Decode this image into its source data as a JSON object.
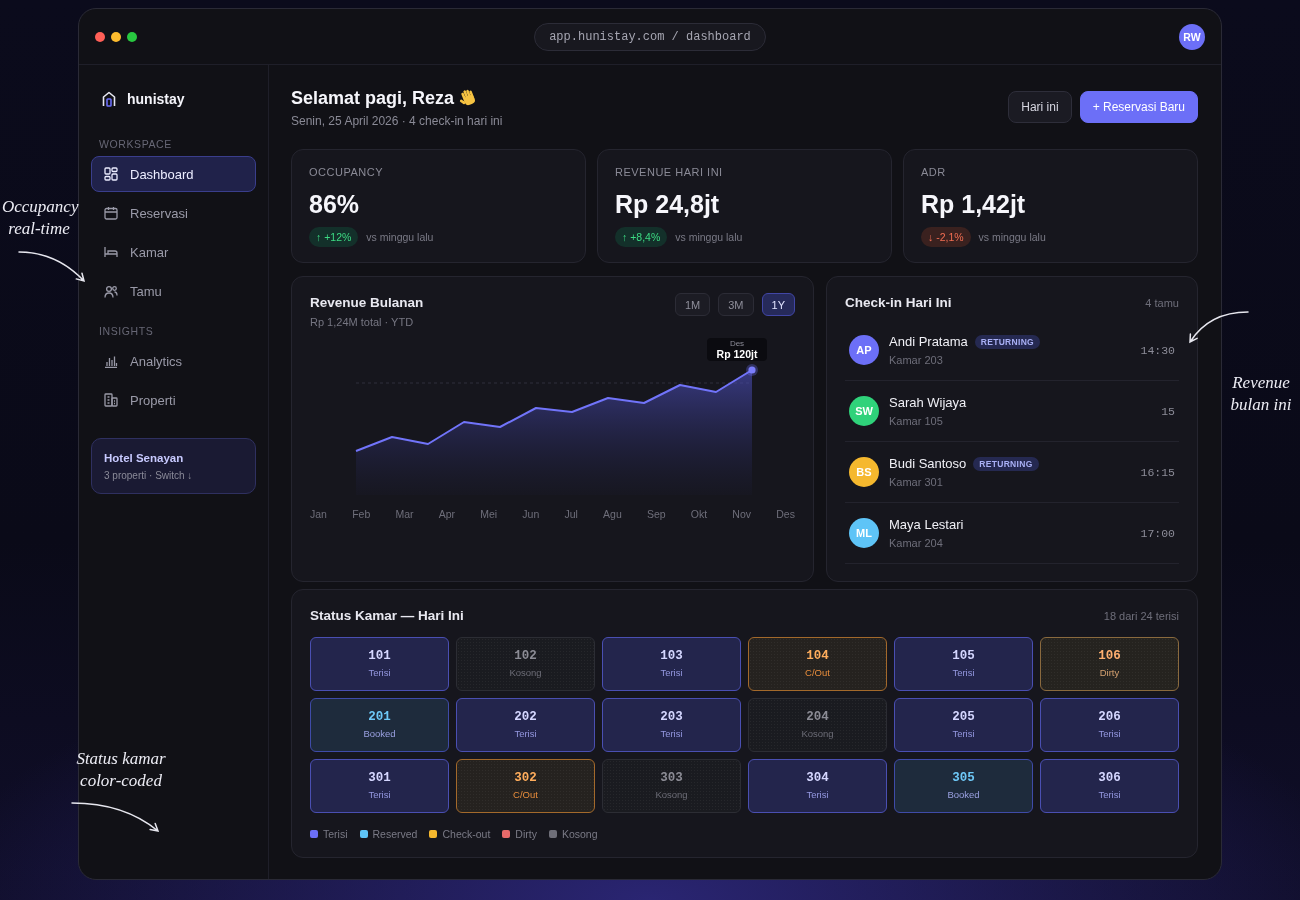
{
  "window": {
    "url": "app.hunistay.com / dashboard",
    "avatar": "RW"
  },
  "sidebar": {
    "brand": "hunistay",
    "sections": [
      {
        "label": "WORKSPACE",
        "items": [
          {
            "label": "Dashboard",
            "selected": true
          },
          {
            "label": "Reservasi",
            "selected": false
          },
          {
            "label": "Kamar",
            "selected": false
          },
          {
            "label": "Tamu",
            "selected": false
          }
        ]
      },
      {
        "label": "INSIGHTS",
        "items": [
          {
            "label": "Analytics",
            "selected": false
          },
          {
            "label": "Properti",
            "selected": false
          }
        ]
      }
    ],
    "property_card": {
      "name": "Hotel Senayan",
      "detail": "3 properti · Switch ↓"
    }
  },
  "header": {
    "greeting": "Selamat pagi, Reza",
    "subtitle": "Senin, 25 April 2026 · 4 check-in hari ini",
    "buttons": [
      {
        "label": "Hari ini",
        "kind": "secondary"
      },
      {
        "label": "+ Reservasi Baru",
        "kind": "primary"
      }
    ]
  },
  "stats": [
    {
      "label": "OCCUPANCY",
      "value": "86%",
      "delta": "↑ +12%",
      "positive": true,
      "note": "vs minggu lalu"
    },
    {
      "label": "REVENUE HARI INI",
      "value": "Rp 24,8jt",
      "delta": "↑ +8,4%",
      "positive": true,
      "note": "vs minggu lalu"
    },
    {
      "label": "ADR",
      "value": "Rp 1,42jt",
      "delta": "↓ -2,1%",
      "positive": false,
      "note": "vs minggu lalu"
    }
  ],
  "revenue_chart": {
    "title": "Revenue Bulanan",
    "subtitle": "Rp 1,24M total · YTD",
    "ranges": [
      {
        "label": "1M",
        "selected": false
      },
      {
        "label": "3M",
        "selected": false
      },
      {
        "label": "1Y",
        "selected": true
      }
    ],
    "months": [
      "Jan",
      "Feb",
      "Mar",
      "Apr",
      "Mei",
      "Jun",
      "Jul",
      "Agu",
      "Sep",
      "Okt",
      "Nov",
      "Des"
    ],
    "tooltip": {
      "label": "Des",
      "value": "Rp 120jt"
    }
  },
  "checkins": {
    "title": "Check-in Hari Ini",
    "count": "4 tamu",
    "guests": [
      {
        "initials": "AP",
        "color": "#6c6ff7",
        "name": "Andi Pratama",
        "badge": "RETURNING",
        "room": "Kamar 203",
        "time": "14:30"
      },
      {
        "initials": "SW",
        "color": "#2fd27a",
        "name": "Sarah Wijaya",
        "room": "Kamar 105",
        "time": "15"
      },
      {
        "initials": "BS",
        "color": "#f5b82e",
        "name": "Budi Santoso",
        "badge": "RETURNING",
        "room": "Kamar 301",
        "time": "16:15"
      },
      {
        "initials": "ML",
        "color": "#5ec4f7",
        "name": "Maya Lestari",
        "room": "Kamar 204",
        "time": "17:00"
      }
    ]
  },
  "room_status": {
    "title": "Status Kamar — Hari Ini",
    "summary": "18 dari 24 terisi",
    "rooms": [
      {
        "number": "101",
        "status": "Terisi",
        "kind": "occupied"
      },
      {
        "number": "102",
        "status": "Kosong",
        "kind": "vacant"
      },
      {
        "number": "103",
        "status": "Terisi",
        "kind": "occupied"
      },
      {
        "number": "104",
        "status": "C/Out",
        "kind": "checkout"
      },
      {
        "number": "105",
        "status": "Terisi",
        "kind": "occupied"
      },
      {
        "number": "106",
        "status": "Dirty",
        "kind": "dirty"
      },
      {
        "number": "201",
        "status": "Booked",
        "kind": "booked"
      },
      {
        "number": "202",
        "status": "Terisi",
        "kind": "occupied"
      },
      {
        "number": "203",
        "status": "Terisi",
        "kind": "occupied"
      },
      {
        "number": "204",
        "status": "Kosong",
        "kind": "vacant"
      },
      {
        "number": "205",
        "status": "Terisi",
        "kind": "occupied"
      },
      {
        "number": "206",
        "status": "Terisi",
        "kind": "occupied"
      },
      {
        "number": "301",
        "status": "Terisi",
        "kind": "occupied"
      },
      {
        "number": "302",
        "status": "C/Out",
        "kind": "checkout"
      },
      {
        "number": "303",
        "status": "Kosong",
        "kind": "vacant"
      },
      {
        "number": "304",
        "status": "Terisi",
        "kind": "occupied"
      },
      {
        "number": "305",
        "status": "Booked",
        "kind": "booked"
      },
      {
        "number": "306",
        "status": "Terisi",
        "kind": "occupied"
      }
    ],
    "legend": [
      {
        "label": "Terisi",
        "color": "#6c6ff7"
      },
      {
        "label": "Reserved",
        "color": "#5ec4f7"
      },
      {
        "label": "Check-out",
        "color": "#f5b82e"
      },
      {
        "label": "Dirty",
        "color": "#e86a6a"
      },
      {
        "label": "Kosong",
        "color": "#6e6e78"
      }
    ]
  },
  "annotations": [
    {
      "text": "Occupancy real-time"
    },
    {
      "text": "Revenue bulan ini"
    },
    {
      "text": "Status kamar color-coded"
    }
  ]
}
